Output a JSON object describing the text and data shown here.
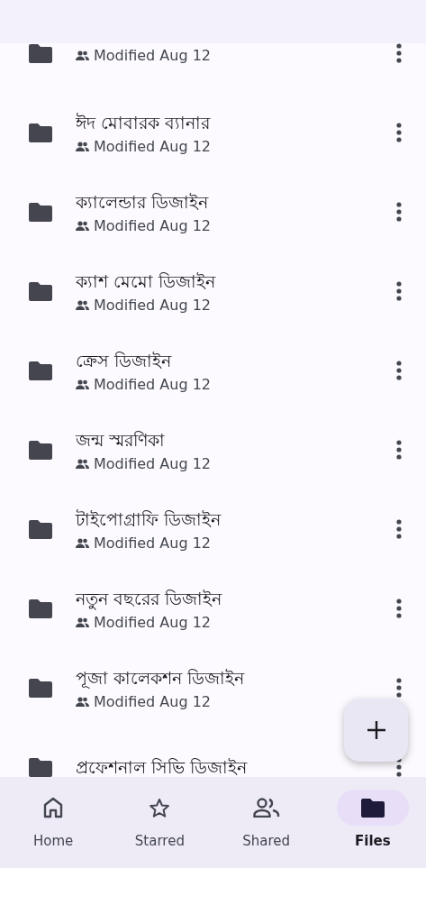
{
  "folders": [
    {
      "subtitle": "Modified Aug 12"
    },
    {
      "title": "ঈদ মোবারক ব্যানার",
      "subtitle": "Modified Aug 12"
    },
    {
      "title": "ক্যালেন্ডার ডিজাইন",
      "subtitle": "Modified Aug 12"
    },
    {
      "title": "ক্যাশ মেমো ডিজাইন",
      "subtitle": "Modified Aug 12"
    },
    {
      "title": "ক্রেস ডিজাইন",
      "subtitle": "Modified Aug 12"
    },
    {
      "title": "জন্ম স্মরণিকা",
      "subtitle": "Modified Aug 12"
    },
    {
      "title": "টাইপোগ্রাফি ডিজাইন",
      "subtitle": "Modified Aug 12"
    },
    {
      "title": "নতুন বছরের ডিজাইন",
      "subtitle": "Modified Aug 12"
    },
    {
      "title": "পূজা কালেকশন ডিজাইন",
      "subtitle": "Modified Aug 12"
    },
    {
      "title": "প্রফেশনাল সিভি ডিজাইন"
    }
  ],
  "nav": [
    {
      "kind": "home",
      "label": "Home",
      "selected": false
    },
    {
      "kind": "star",
      "label": "Starred",
      "selected": false
    },
    {
      "kind": "shared",
      "label": "Shared",
      "selected": false
    },
    {
      "kind": "files",
      "label": "Files",
      "selected": true
    }
  ]
}
